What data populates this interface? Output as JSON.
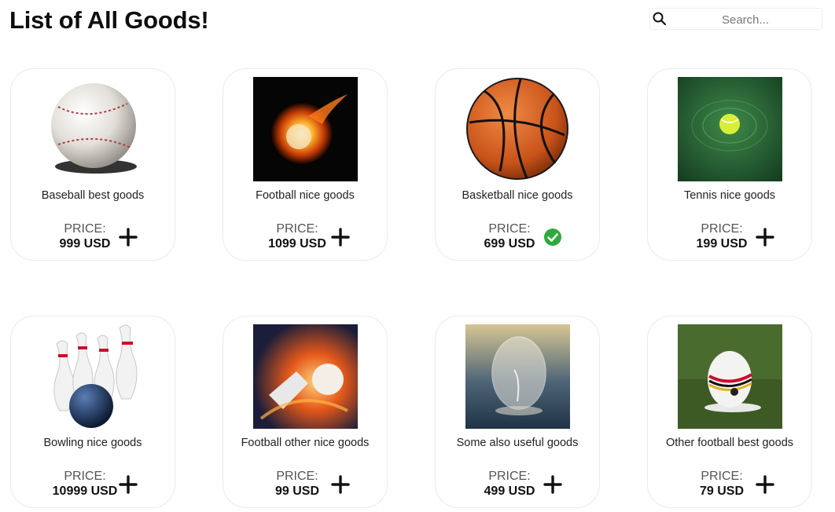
{
  "page": {
    "title": "List of All Goods!"
  },
  "search": {
    "placeholder": "Search...",
    "icon": "search-icon"
  },
  "price_label": "PRICE:",
  "products": [
    {
      "name": "Baseball best goods",
      "price": "999 USD",
      "image": "baseball",
      "action": "add"
    },
    {
      "name": "Football nice goods",
      "price": "1099 USD",
      "image": "fire-football",
      "action": "add"
    },
    {
      "name": "Basketball nice goods",
      "price": "699 USD",
      "image": "basketball",
      "action": "added"
    },
    {
      "name": "Tennis nice goods",
      "price": "199 USD",
      "image": "tennis",
      "action": "add"
    },
    {
      "name": "Bowling nice goods",
      "price": "10999 USD",
      "image": "bowling",
      "action": "add"
    },
    {
      "name": "Football other nice goods",
      "price": "99 USD",
      "image": "fire-kick",
      "action": "add"
    },
    {
      "name": "Some also useful goods",
      "price": "499 USD",
      "image": "bubble",
      "action": "add"
    },
    {
      "name": "Other football best goods",
      "price": "79 USD",
      "image": "grass-football",
      "action": "add"
    }
  ],
  "colors": {
    "added_check": "#2eaa3c",
    "add_plus": "#111111"
  }
}
